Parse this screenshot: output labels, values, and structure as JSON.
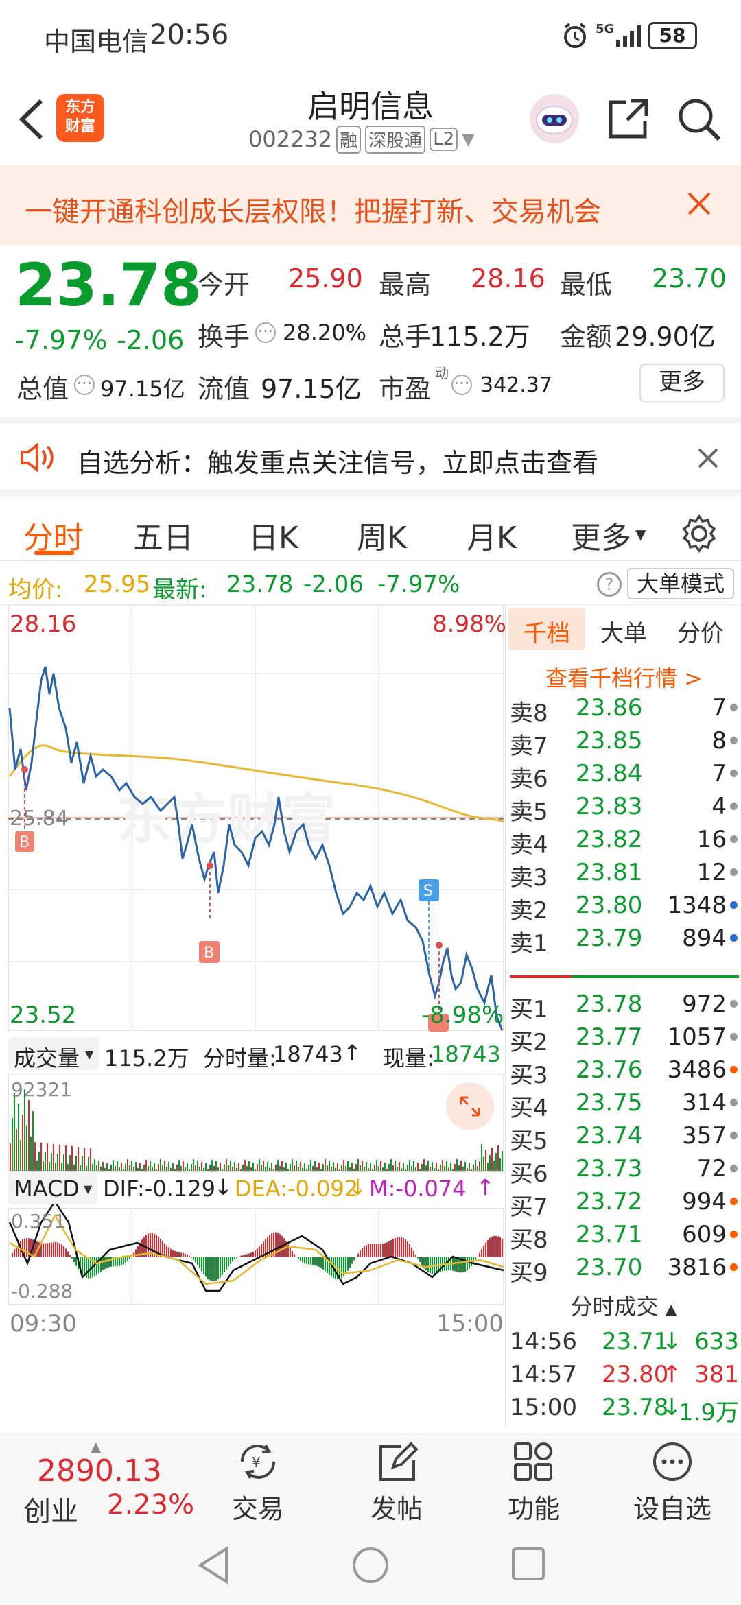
{
  "status_bar": {
    "carrier": "中国电信",
    "time": "20:56",
    "network": "5G",
    "battery": "58"
  },
  "header": {
    "brand_line1": "东方",
    "brand_line2": "财富",
    "stock_name": "启明信息",
    "stock_code": "002232",
    "tag_rong": "融",
    "tag_sgt": "深股通",
    "tag_level": "L2"
  },
  "banner": {
    "text": "一键开通科创成长层权限！把握打新、交易机会"
  },
  "quote": {
    "price": "23.78",
    "change_pct": "-7.97%",
    "change": "-2.06",
    "open_label": "今开",
    "open": "25.90",
    "high_label": "最高",
    "high": "28.16",
    "low_label": "最低",
    "low": "23.70",
    "turnover_label": "换手",
    "turnover": "28.20%",
    "volume_label": "总手",
    "volume": "115.2万",
    "amount_label": "金额",
    "amount": "29.90亿",
    "mktcap_label": "总值",
    "mktcap": "97.15亿",
    "float_label": "流值",
    "float": "97.15亿",
    "pe_label": "市盈",
    "pe_sup": "动",
    "pe": "342.37",
    "more": "更多"
  },
  "notice": {
    "text": "自选分析：触发重点关注信号，立即点击查看"
  },
  "tabs": [
    "分时",
    "五日",
    "日K",
    "周K",
    "月K",
    "更多"
  ],
  "avg_line": {
    "avg_label": "均价:",
    "avg": "25.95",
    "last_label": "最新:",
    "last": "23.78",
    "chg": "-2.06",
    "chg_pct": "-7.97%",
    "mode_button": "大单模式"
  },
  "chart": {
    "high_price": "28.16",
    "high_pct": "8.98%",
    "low_price": "23.52",
    "low_pct": "-8.98%",
    "ref_price": "25.84",
    "watermark": "东方财富",
    "time_start": "09:30",
    "time_end": "15:00",
    "vol_selector": "成交量",
    "vol_total": "115.2万",
    "vol_period_label": "分时量:",
    "vol_period": "18743",
    "vol_now_label": "现量:",
    "vol_now": "18743",
    "vol_max": "92321",
    "macd_selector": "MACD",
    "dif": "DIF:-0.129",
    "dea": "DEA:-0.092",
    "m": "M:-0.074",
    "macd_top": "0.351",
    "macd_bottom": "-0.288",
    "marker_b": "B",
    "marker_s": "S"
  },
  "book": {
    "tabs": [
      "千档",
      "大单",
      "分价"
    ],
    "link": "查看千档行情 >",
    "sell": [
      {
        "name": "卖8",
        "price": "23.86",
        "vol": "7",
        "dot": "#999999"
      },
      {
        "name": "卖7",
        "price": "23.85",
        "vol": "8",
        "dot": "#999999"
      },
      {
        "name": "卖6",
        "price": "23.84",
        "vol": "7",
        "dot": "#999999"
      },
      {
        "name": "卖5",
        "price": "23.83",
        "vol": "4",
        "dot": "#999999"
      },
      {
        "name": "卖4",
        "price": "23.82",
        "vol": "16",
        "dot": "#999999"
      },
      {
        "name": "卖3",
        "price": "23.81",
        "vol": "12",
        "dot": "#999999"
      },
      {
        "name": "卖2",
        "price": "23.80",
        "vol": "1348",
        "dot": "#2a6fd6"
      },
      {
        "name": "卖1",
        "price": "23.79",
        "vol": "894",
        "dot": "#2a6fd6"
      }
    ],
    "buy": [
      {
        "name": "买1",
        "price": "23.78",
        "vol": "972",
        "dot": "#999999"
      },
      {
        "name": "买2",
        "price": "23.77",
        "vol": "1057",
        "dot": "#999999"
      },
      {
        "name": "买3",
        "price": "23.76",
        "vol": "3486",
        "dot": "#ff5a00"
      },
      {
        "name": "买4",
        "price": "23.75",
        "vol": "314",
        "dot": "#999999"
      },
      {
        "name": "买5",
        "price": "23.74",
        "vol": "357",
        "dot": "#999999"
      },
      {
        "name": "买6",
        "price": "23.73",
        "vol": "72",
        "dot": "#999999"
      },
      {
        "name": "买7",
        "price": "23.72",
        "vol": "994",
        "dot": "#ff5a00"
      },
      {
        "name": "买8",
        "price": "23.71",
        "vol": "609",
        "dot": "#ff5a00"
      },
      {
        "name": "买9",
        "price": "23.70",
        "vol": "3816",
        "dot": "#ff5a00"
      }
    ],
    "ticks_title": "分时成交",
    "ticks": [
      {
        "time": "14:56",
        "price": "23.71",
        "arrow": "↓",
        "vol": "633",
        "color": "#0a9b2d"
      },
      {
        "time": "14:57",
        "price": "23.80",
        "arrow": "↑",
        "vol": "381",
        "color": "#e0282e"
      },
      {
        "time": "15:00",
        "price": "23.78",
        "arrow": "↓",
        "vol": "1.9万",
        "color": "#0a9b2d"
      }
    ]
  },
  "bottom_nav": {
    "index_value": "2890.13",
    "index_name": "创业",
    "index_pct": "2.23%",
    "items": [
      "交易",
      "发帖",
      "功能",
      "设自选"
    ]
  }
}
